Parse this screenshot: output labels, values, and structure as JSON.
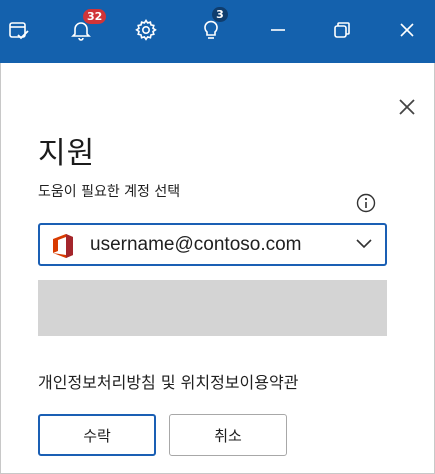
{
  "titlebar": {
    "bg_color": "#1461ad",
    "icons": [
      "calendar-check-icon",
      "bell-icon",
      "gear-icon",
      "lightbulb-icon",
      "minimize-icon",
      "restore-icon",
      "close-icon"
    ],
    "notifications_count": "32",
    "tips_count": "3"
  },
  "dialog": {
    "title": "지원",
    "account_label": "도움이 필요한 계정 선택",
    "account_select": {
      "value": "username@contoso.com",
      "icon": "office-logo-icon"
    },
    "privacy_text": "개인정보처리방침 및 위치정보이용약관",
    "ok_button": "수락",
    "cancel_button": "취소",
    "accent_color": "#1a5fb4"
  }
}
